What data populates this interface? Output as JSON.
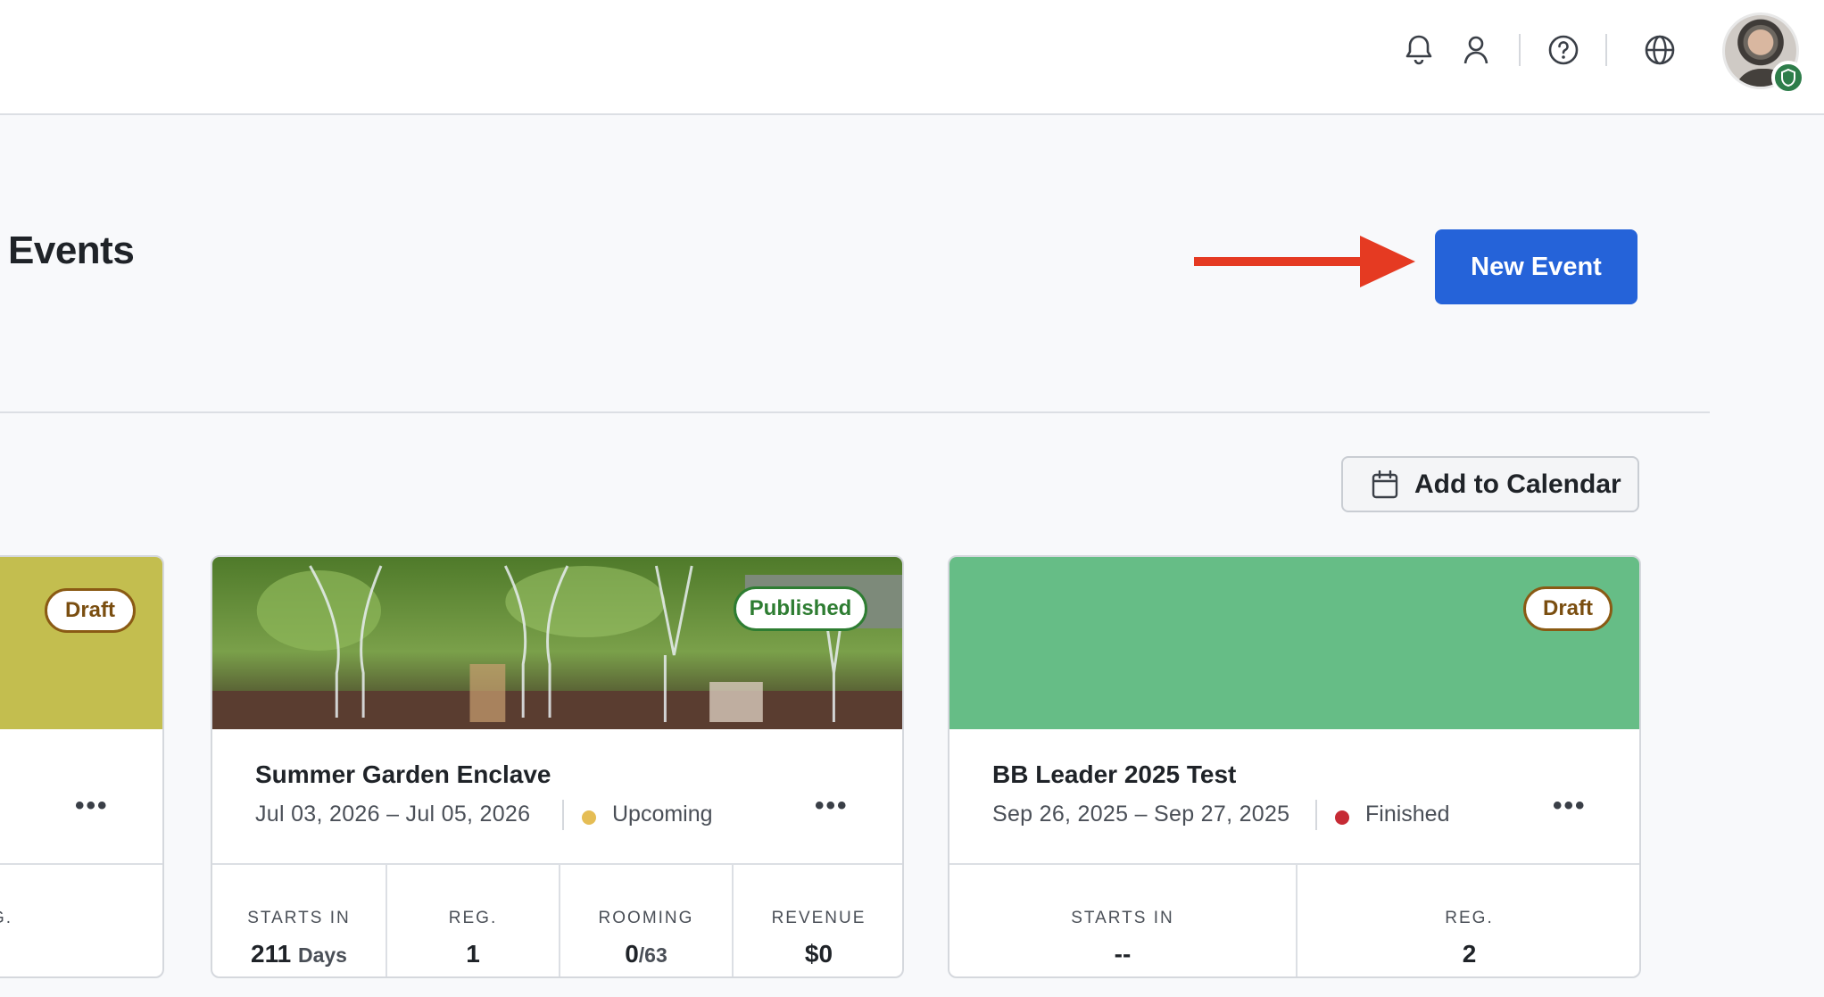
{
  "page": {
    "title": "Events"
  },
  "actions": {
    "new_event": "New Event",
    "add_to_calendar": "Add to Calendar"
  },
  "colors": {
    "primary": "#2563d9",
    "arrow": "#e53a22",
    "upcoming_dot": "#e5bd55",
    "finished_dot": "#c62b35",
    "banner_olive": "#c3be4f",
    "banner_green": "#66bd86"
  },
  "cards": [
    {
      "badge": "Draft",
      "stat_label_fragment": "G."
    },
    {
      "name": "Summer Garden Enclave",
      "dates": "Jul 03, 2026 – Jul 05, 2026",
      "status": "Upcoming",
      "badge": "Published",
      "stats": [
        {
          "label": "STARTS IN",
          "value": "211",
          "unit": "Days"
        },
        {
          "label": "REG.",
          "value": "1"
        },
        {
          "label": "ROOMING",
          "value": "0",
          "unit": "/63"
        },
        {
          "label": "REVENUE",
          "value": "$0"
        }
      ]
    },
    {
      "name": "BB Leader 2025 Test",
      "dates": "Sep 26, 2025 – Sep 27, 2025",
      "status": "Finished",
      "badge": "Draft",
      "stats": [
        {
          "label": "STARTS IN",
          "value": "--"
        },
        {
          "label": "REG.",
          "value": "2"
        }
      ]
    }
  ],
  "icons": [
    "bell-icon",
    "user-icon",
    "help-icon",
    "globe-icon",
    "calendar-icon",
    "more-icon",
    "arrow-right-icon"
  ]
}
